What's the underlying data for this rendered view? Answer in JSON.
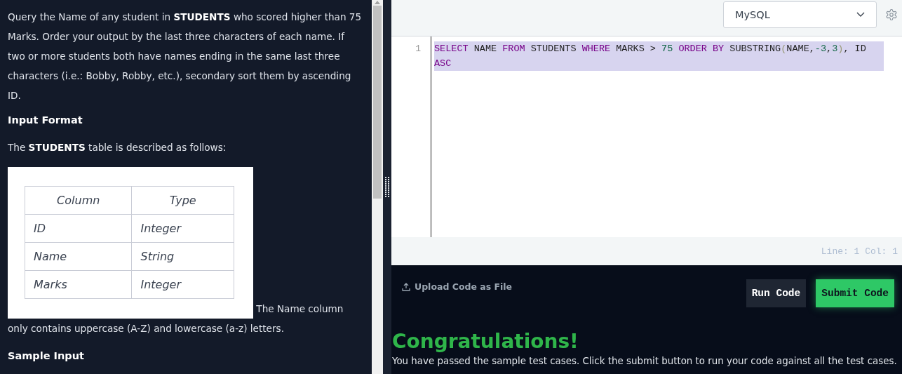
{
  "problem": {
    "intro": "Query the Name of any student in **STUDENTS** who scored higher than 75 Marks. Order your output by the last three characters of each name. If two or more students both have names ending in the same last three characters (i.e.: Bobby, Robby, etc.), secondary sort them by ascending ID.",
    "input_heading": "Input Format",
    "table_intro": "The **STUDENTS** table is described as follows:",
    "table": {
      "columns": [
        "Column",
        "Type"
      ],
      "rows": [
        [
          "ID",
          "Integer"
        ],
        [
          "Name",
          "String"
        ],
        [
          "Marks",
          "Integer"
        ]
      ]
    },
    "after_table": "The Name column only contains uppercase (A-Z) and lowercase (a-z) letters.",
    "sample_heading": "Sample Input"
  },
  "editor": {
    "language": "MySQL",
    "line_numbers": [
      "1"
    ],
    "code": [
      {
        "kind": "keyword",
        "text": "SELECT"
      },
      {
        "kind": "plain",
        "text": " NAME "
      },
      {
        "kind": "keyword",
        "text": "FROM"
      },
      {
        "kind": "plain",
        "text": " STUDENTS "
      },
      {
        "kind": "keyword",
        "text": "WHERE"
      },
      {
        "kind": "plain",
        "text": " MARKS > "
      },
      {
        "kind": "number",
        "text": "75"
      },
      {
        "kind": "keyword",
        "text": " ORDER BY"
      },
      {
        "kind": "plain",
        "text": " SUBSTRING"
      },
      {
        "kind": "paren",
        "text": "("
      },
      {
        "kind": "plain",
        "text": "NAME,"
      },
      {
        "kind": "number",
        "text": "-3"
      },
      {
        "kind": "plain",
        "text": ","
      },
      {
        "kind": "number",
        "text": "3"
      },
      {
        "kind": "paren",
        "text": ")"
      },
      {
        "kind": "plain",
        "text": ", ID "
      },
      {
        "kind": "keyword",
        "text": "ASC"
      }
    ],
    "selected": true,
    "status": "Line: 1 Col: 1"
  },
  "actions": {
    "upload": "Upload Code as File",
    "run": "Run Code",
    "submit": "Submit Code"
  },
  "result": {
    "title": "Congratulations!",
    "message": "You have passed the sample test cases. Click the submit button to run your code against all the test cases."
  }
}
